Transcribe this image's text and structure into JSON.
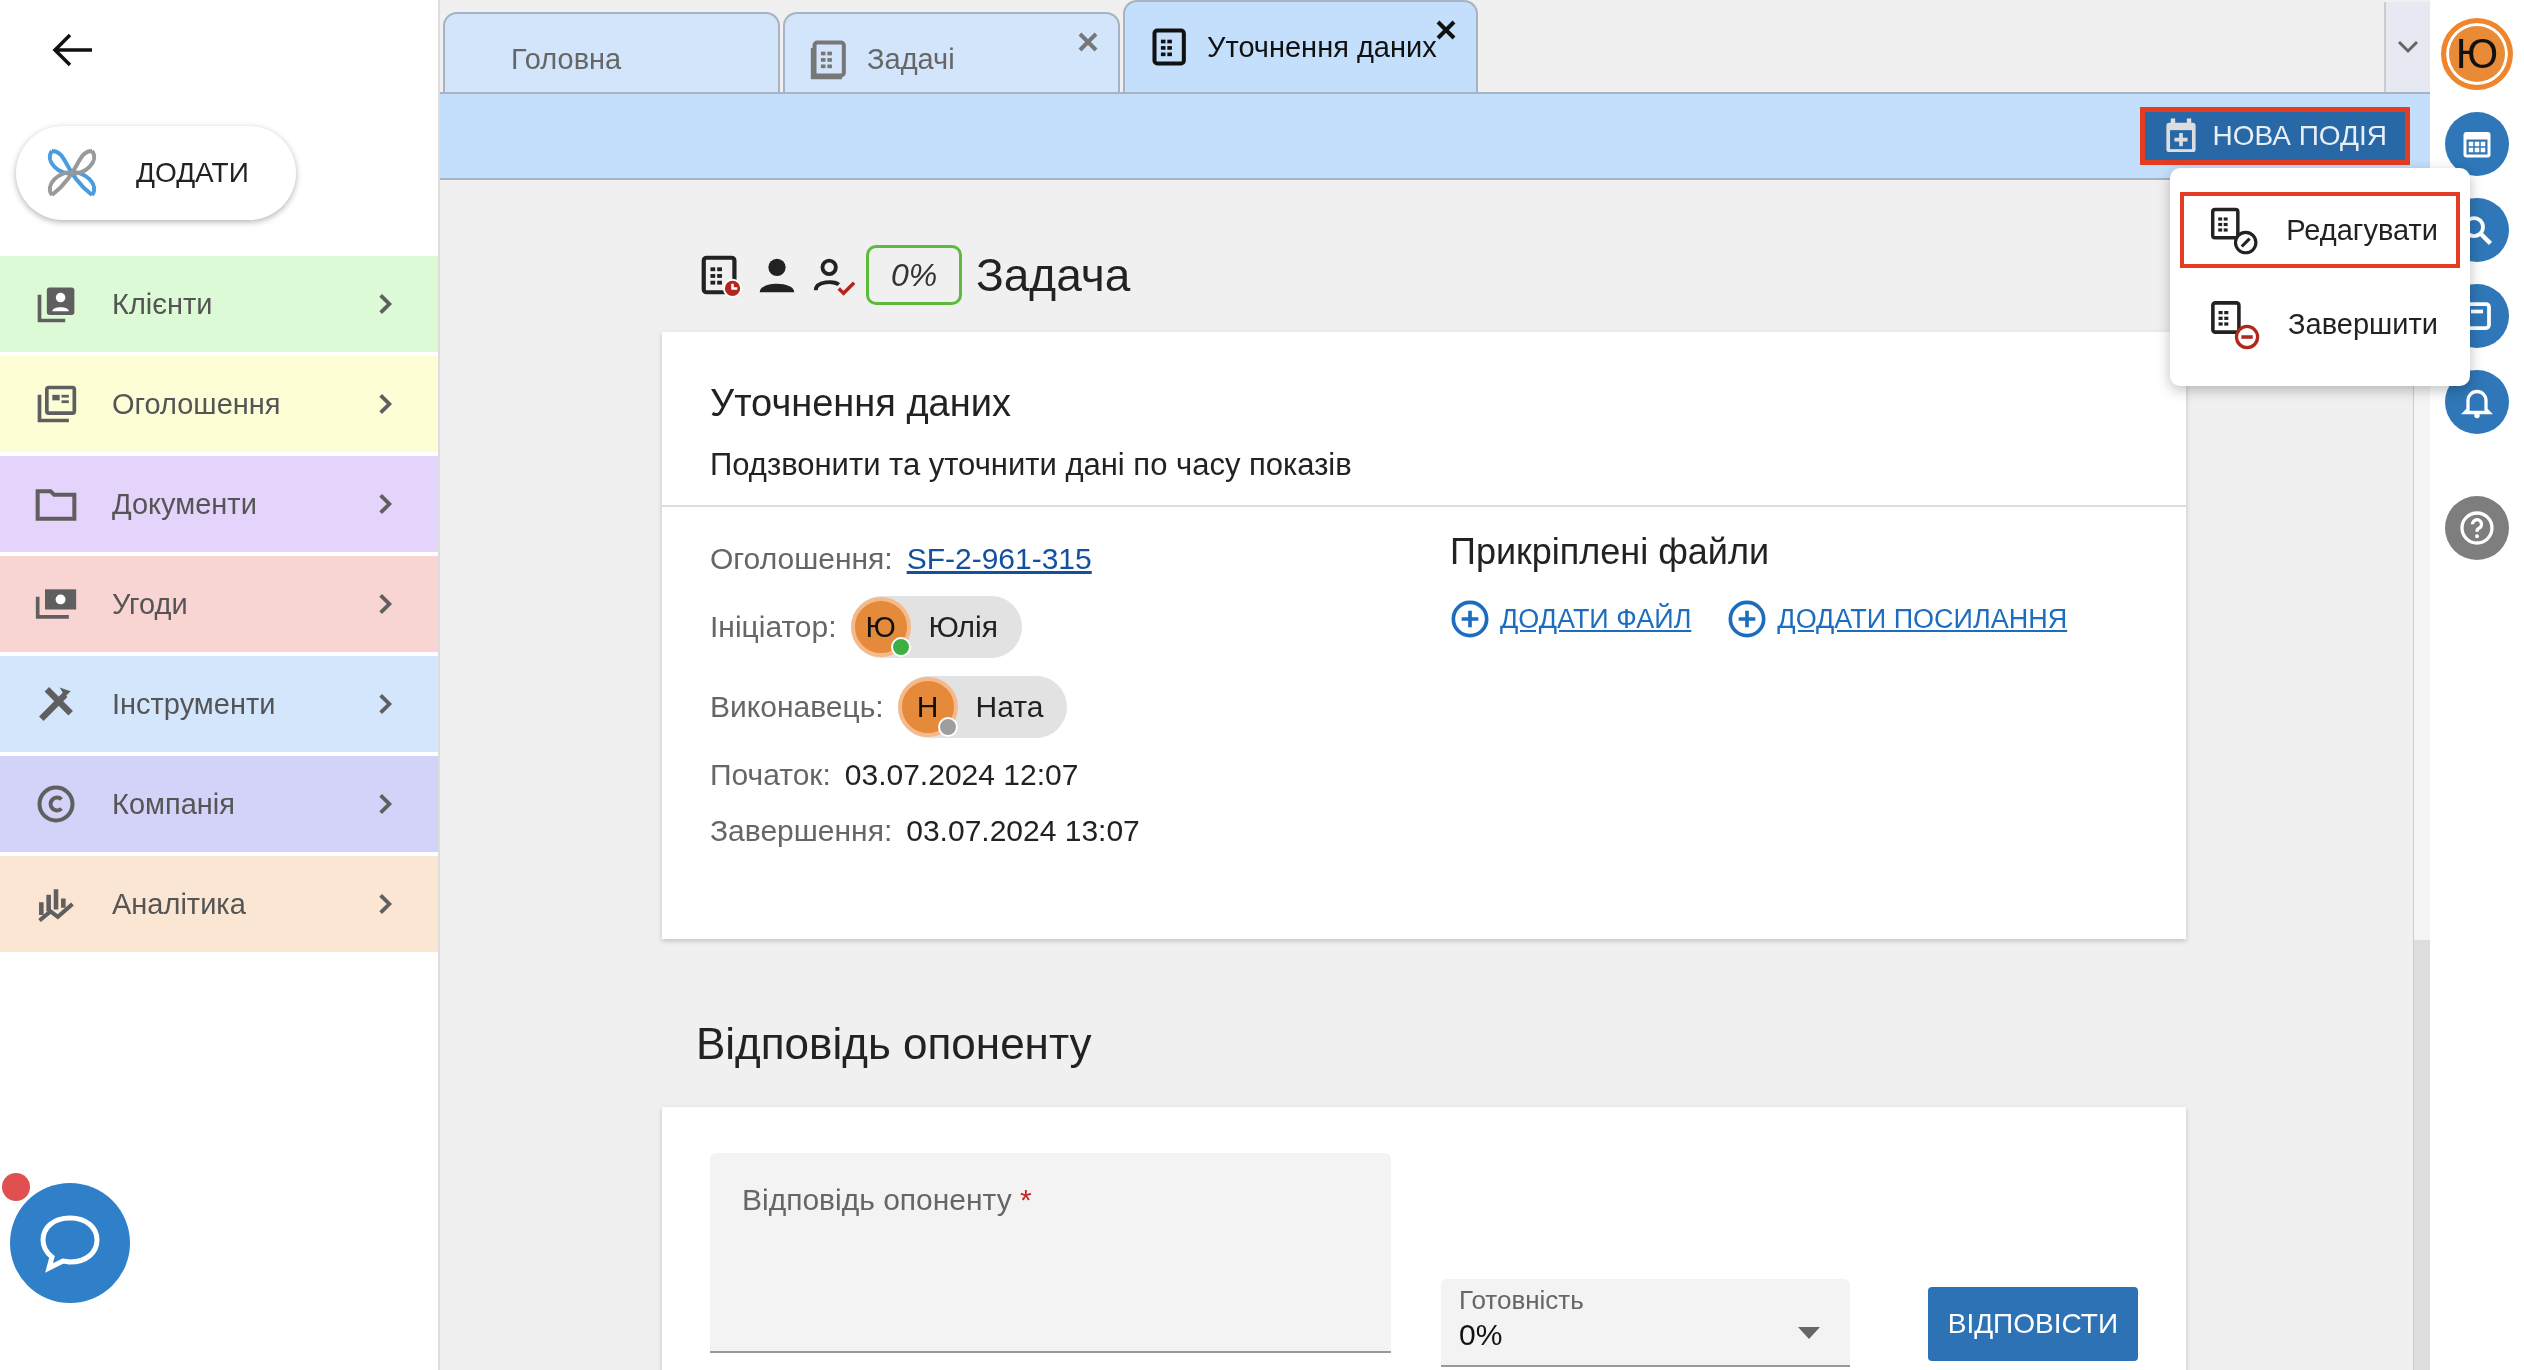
{
  "add_button": {
    "label": "ДОДАТИ"
  },
  "menu": [
    {
      "label": "Клієнти",
      "color": "#dcfad6",
      "kind": "clients"
    },
    {
      "label": "Оголошення",
      "color": "#fdfdd6",
      "kind": "ads"
    },
    {
      "label": "Документи",
      "color": "#e4d3fb",
      "kind": "docs"
    },
    {
      "label": "Угоди",
      "color": "#f8d4d2",
      "kind": "deals"
    },
    {
      "label": "Інструменти",
      "color": "#d4e6fc",
      "kind": "tools"
    },
    {
      "label": "Компанія",
      "color": "#d3d2f8",
      "kind": "company"
    },
    {
      "label": "Аналітика",
      "color": "#fae6d3",
      "kind": "analytics"
    }
  ],
  "tabs": [
    {
      "label": "Головна",
      "selected": false,
      "kind": "home"
    },
    {
      "label": "Задачі",
      "selected": false,
      "kind": "list"
    },
    {
      "label": "Уточнення даних",
      "selected": true,
      "kind": "task"
    }
  ],
  "new_event": {
    "label": "НОВА ПОДІЯ",
    "highlighted": true
  },
  "action_menu": [
    {
      "label": "Редагувати",
      "kind": "edit",
      "selected": true
    },
    {
      "label": "Завершити",
      "kind": "finish",
      "selected": false
    }
  ],
  "user_avatar": {
    "initial": "Ю"
  },
  "task": {
    "progress": "0%",
    "type": "Задача",
    "title": "Уточнення даних",
    "description": "Подзвонити та уточнити дані по часу показів",
    "fields": [
      {
        "label": "Оголошення:",
        "kind": "link",
        "value": "SF-2-961-315"
      },
      {
        "label": "Ініціатор:",
        "kind": "person",
        "initial": "Ю",
        "value": "Юлія",
        "online": true
      },
      {
        "label": "Виконавець:",
        "kind": "person",
        "initial": "Н",
        "value": "Ната",
        "online": false
      },
      {
        "label": "Початок:",
        "kind": "text",
        "value": "03.07.2024 12:07"
      },
      {
        "label": "Завершення:",
        "kind": "text",
        "value": "03.07.2024 13:07"
      }
    ],
    "attachments": {
      "title": "Прикріплені файли",
      "actions": [
        "ДОДАТИ ФАЙЛ",
        "ДОДАТИ ПОСИЛАННЯ"
      ]
    }
  },
  "reply": {
    "title": "Відповідь опоненту",
    "field": {
      "label": "Відповідь опоненту",
      "required_mark": "*"
    },
    "readiness": {
      "label": "Готовність",
      "value": "0%"
    },
    "submit": "ВІДПОВІСТИ"
  }
}
